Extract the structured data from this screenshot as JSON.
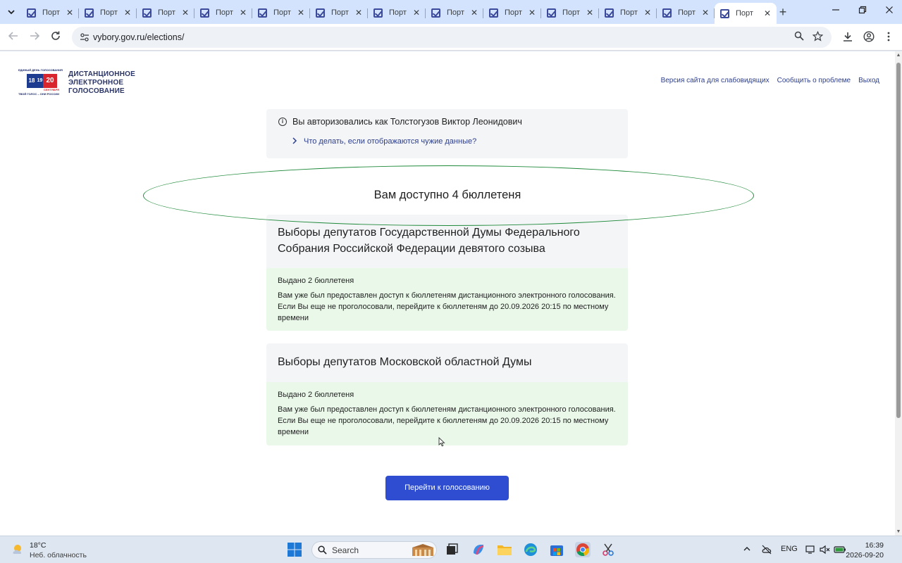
{
  "browser": {
    "tabs": [
      {
        "title": "Порт",
        "active": false
      },
      {
        "title": "Порт",
        "active": false
      },
      {
        "title": "Порт",
        "active": false
      },
      {
        "title": "Порт",
        "active": false
      },
      {
        "title": "Порт",
        "active": false
      },
      {
        "title": "Порт",
        "active": false
      },
      {
        "title": "Порт",
        "active": false
      },
      {
        "title": "Порт",
        "active": false
      },
      {
        "title": "Порт",
        "active": false
      },
      {
        "title": "Порт",
        "active": false
      },
      {
        "title": "Порт",
        "active": false
      },
      {
        "title": "Порт",
        "active": false
      },
      {
        "title": "Порт",
        "active": true
      }
    ],
    "new_tab_glyph": "+",
    "url": "vybory.gov.ru/elections/",
    "accent_color": "#d3e3fd"
  },
  "site": {
    "logo": {
      "top_text": "ЕДИНЫЙ ДЕНЬ ГОЛОСОВАНИЯ",
      "day1": "18",
      "day2": "19",
      "day3": "20",
      "month": "СЕНТЯБРЯ",
      "bottom_text": "ТВОЙ ГОЛОС – ОНИ РОССИИ"
    },
    "brand_lines": [
      "ДИСТАНЦИОННОЕ",
      "ЭЛЕКТРОННОЕ",
      "ГОЛОСОВАНИЕ"
    ],
    "top_links": [
      "Версия сайта для слабовидящих",
      "Сообщить о проблеме",
      "Выход"
    ],
    "auth": {
      "text": "Вы авторизовались как Толстогузов Виктор Леонидович",
      "help_link": "Что делать, если отображаются чужие данные?"
    },
    "available_text": "Вам доступно 4 бюллетеня",
    "annotation_color": "#1f8a3a",
    "elections": [
      {
        "title": "Выборы депутатов Государственной Думы Федерального Собрания Российской Федерации девятого созыва",
        "issued": "Выдано 2 бюллетеня",
        "message": "Вам уже был предоставлен доступ к бюллетеням дистанционного электронного голосования. Если Вы еще не проголосовали, перейдите к бюллетеням до 20.09.2026 20:15 по местному времени"
      },
      {
        "title": "Выборы депутатов Московской областной Думы",
        "issued": "Выдано 2 бюллетеня",
        "message": "Вам уже был предоставлен доступ к бюллетеням дистанционного электронного голосования. Если Вы еще не проголосовали, перейдите к бюллетеням до 20.09.2026 20:15 по местному времени"
      }
    ],
    "vote_button": "Перейти к голосованию",
    "button_color": "#2e4dd0"
  },
  "taskbar": {
    "weather_temp": "18°C",
    "weather_desc": "Неб. облачность",
    "search_placeholder": "Search",
    "language": "ENG",
    "time": "16:39",
    "date": "2026-09-20"
  }
}
